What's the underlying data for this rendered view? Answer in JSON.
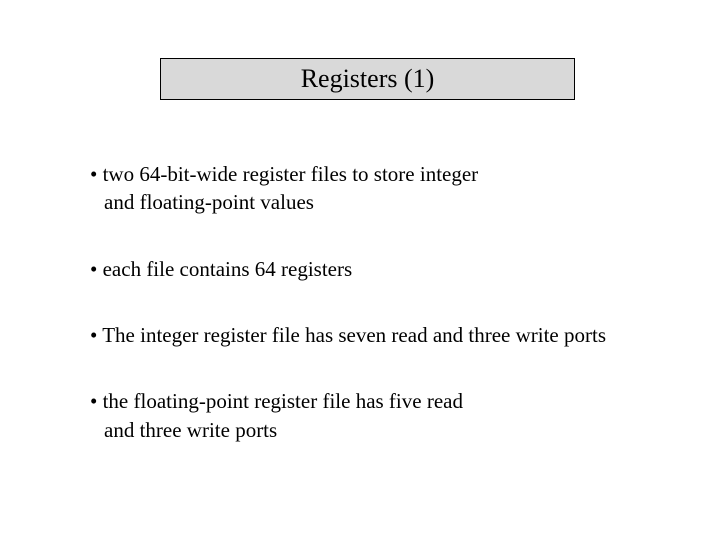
{
  "title": "Registers (1)",
  "bullets": [
    {
      "line1": "• two 64-bit-wide register files to store integer",
      "line2": "and floating-point values"
    },
    {
      "line1": "• each file contains 64 registers"
    },
    {
      "line1": "• The integer register file has seven read and three write ports"
    },
    {
      "line1": "• the floating-point register file has five read",
      "line2": "and three write ports"
    }
  ]
}
